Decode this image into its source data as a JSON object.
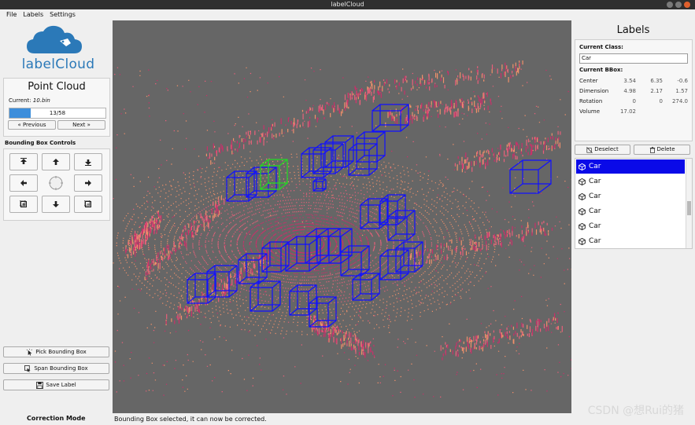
{
  "window": {
    "title": "labelCloud"
  },
  "menu": {
    "file": "File",
    "labels": "Labels",
    "settings": "Settings"
  },
  "logo": {
    "text": "labelCloud",
    "color": "#2b79b8"
  },
  "point_cloud": {
    "title": "Point Cloud",
    "current_label": "Current:",
    "current_file": "10.bin",
    "progress_text": "13/58",
    "progress_value": 13,
    "progress_max": 58,
    "prev_label": "« Previous",
    "next_label": "Next »"
  },
  "bbox_controls": {
    "title": "Bounding Box Controls",
    "icons": [
      "move-up-icon",
      "move-forward-icon",
      "move-down-icon",
      "move-left-icon",
      "rotate-dial-icon",
      "move-right-icon",
      "increase-icon",
      "move-backward-icon",
      "decrease-icon"
    ]
  },
  "tools": {
    "pick_label": "Pick Bounding Box",
    "span_label": "Span Bounding Box",
    "save_label": "Save Label"
  },
  "mode": {
    "label": "Correction Mode"
  },
  "status": {
    "text": "Bounding Box selected, it can now be corrected."
  },
  "labels_panel": {
    "title": "Labels",
    "current_class_label": "Current Class:",
    "current_class_value": "Car",
    "current_bbox_label": "Current BBox:",
    "rows": [
      {
        "name": "Center",
        "v1": "3.54",
        "v2": "6.35",
        "v3": "-0.6"
      },
      {
        "name": "Dimension",
        "v1": "4.98",
        "v2": "2.17",
        "v3": "1.57"
      },
      {
        "name": "Rotation",
        "v1": "0",
        "v2": "0",
        "v3": "274.0"
      },
      {
        "name": "Volume",
        "v1": "17.02",
        "v2": "",
        "v3": ""
      }
    ],
    "deselect_label": "Deselect",
    "delete_label": "Delete",
    "items": [
      "Car",
      "Car",
      "Car",
      "Car",
      "Car",
      "Car"
    ],
    "selected_index": 0,
    "selected_color": "#0a0ae8"
  },
  "viewer": {
    "background": "#666666",
    "bbox_color": "#1010ff",
    "selected_bbox_color": "#22dd22",
    "point_colors": [
      "#f0906a",
      "#e8607a",
      "#c8306a"
    ]
  },
  "watermark": {
    "text": "CSDN @想Rui的猪"
  }
}
